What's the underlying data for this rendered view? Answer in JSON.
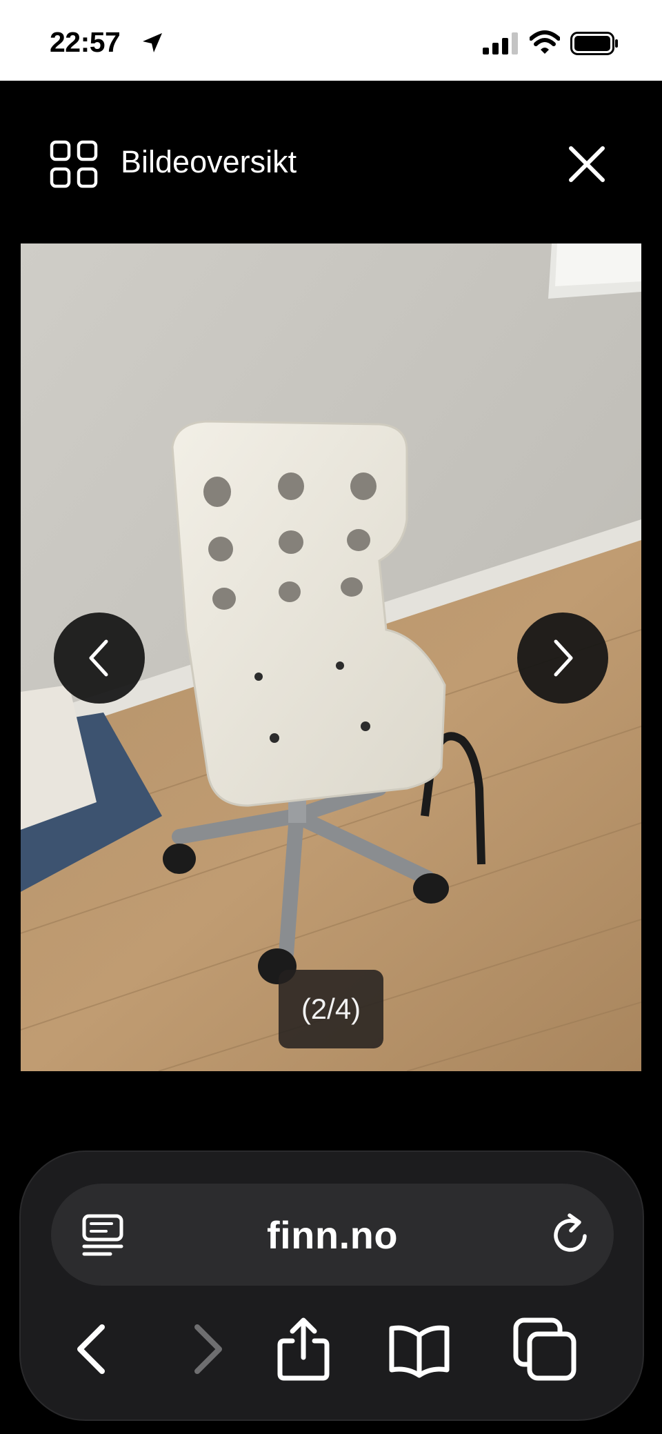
{
  "status_bar": {
    "time": "22:57"
  },
  "header": {
    "title": "Bildeoversikt",
    "grid_icon": "grid-icon",
    "close_icon": "close-icon"
  },
  "gallery": {
    "counter": "(2/4)",
    "prev_icon": "chevron-left-icon",
    "next_icon": "chevron-right-icon"
  },
  "browser": {
    "url": "finn.no",
    "reader_icon": "reader-icon",
    "reload_icon": "reload-icon",
    "toolbar": [
      "back-icon",
      "forward-icon",
      "share-icon",
      "bookmarks-icon",
      "tabs-icon"
    ]
  },
  "colors": {
    "background": "#000000",
    "toolbar": "#1c1c1e",
    "address_field": "#2c2c2e",
    "text": "#ffffff"
  }
}
